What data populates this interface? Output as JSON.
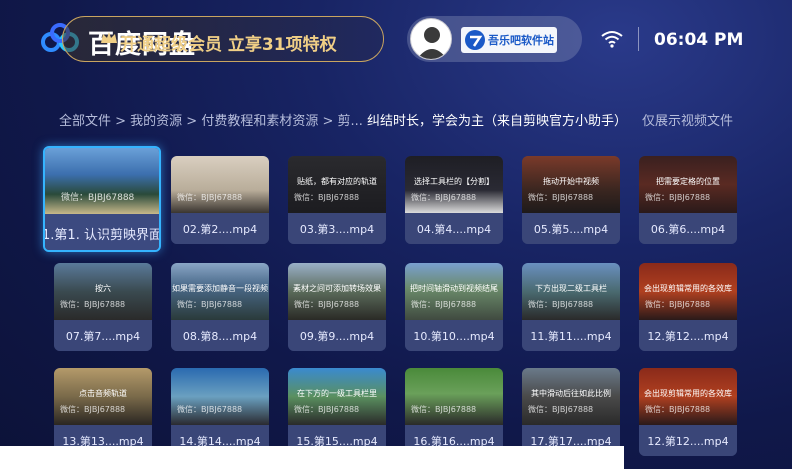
{
  "header": {
    "app_title": "百度网盘",
    "vip_promo": "开通超级会员 立享31项特权",
    "user_badge_text": "吾乐吧软件站",
    "clock": "06:04 PM"
  },
  "breadcrumb": {
    "path": "全部文件 > 我的资源 > 付费教程和素材资源 > 剪... ",
    "current": "纠结时长，学会为主（来自剪映官方小助手）"
  },
  "filter_label": "仅展示视频文件",
  "watermark": "微信：BJBJ67888",
  "files": [
    {
      "caption": "1.第1. 认识剪映界面",
      "overlay": ""
    },
    {
      "caption": "02.第2....mp4",
      "overlay": ""
    },
    {
      "caption": "03.第3....mp4",
      "overlay": "贴纸，都有对应的轨道"
    },
    {
      "caption": "04.第4....mp4",
      "overlay": "选择工具栏的【分割】"
    },
    {
      "caption": "05.第5....mp4",
      "overlay": "拖动开始中视频"
    },
    {
      "caption": "06.第6....mp4",
      "overlay": "把需要定格的位置"
    },
    {
      "caption": "07.第7....mp4",
      "overlay": "按六"
    },
    {
      "caption": "08.第8....mp4",
      "overlay": "如果需要添加静音一段视频"
    },
    {
      "caption": "09.第9....mp4",
      "overlay": "素材之间可添加转场效果"
    },
    {
      "caption": "10.第10....mp4",
      "overlay": "把时间轴滑动到视频结尾"
    },
    {
      "caption": "11.第11....mp4",
      "overlay": "下方出现二级工具栏"
    },
    {
      "caption": "12.第12....mp4",
      "overlay": "会出现剪辑常用的各效库"
    },
    {
      "caption": "13.第13....mp4",
      "overlay": "点击音频轨道"
    },
    {
      "caption": "14.第14....mp4",
      "overlay": ""
    },
    {
      "caption": "15.第15....mp4",
      "overlay": "在下方的一级工具栏里"
    },
    {
      "caption": "16.第16....mp4",
      "overlay": ""
    },
    {
      "caption": "17.第17....mp4",
      "overlay": "其中滑动后往如此比例"
    },
    {
      "caption": "12.第12....mp4",
      "overlay": "会出现剪辑常用的各效库"
    }
  ],
  "colors": {
    "accent": "#35b4ff",
    "vip_gold": "#f0cf86"
  }
}
